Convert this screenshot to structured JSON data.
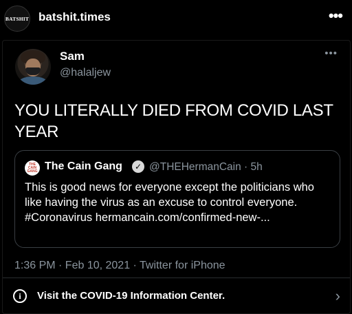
{
  "post": {
    "avatar_text": "BATSHIT",
    "username": "batshit.times",
    "more_icon": "ellipsis-icon"
  },
  "tweet": {
    "name": "Sam",
    "handle": "@halaljew",
    "text": "YOU LITERALLY DIED FROM COVID LAST YEAR",
    "quote": {
      "avatar_text": "THE CAIN GANG",
      "name": "The Cain Gang",
      "verified_icon": "verified-badge-icon",
      "handle_time": "@THEHermanCain · 5h",
      "text": "This is good news for everyone except the politicians who like having the virus as an excuse to control everyone. #Coronavirus hermancain.com/confirmed-new-..."
    },
    "meta": "1:36 PM · Feb 10, 2021 · Twitter for iPhone"
  },
  "info_bar": {
    "icon": "info-icon",
    "text": "Visit the COVID-19 Information Center.",
    "chevron": "chevron-right-icon"
  }
}
